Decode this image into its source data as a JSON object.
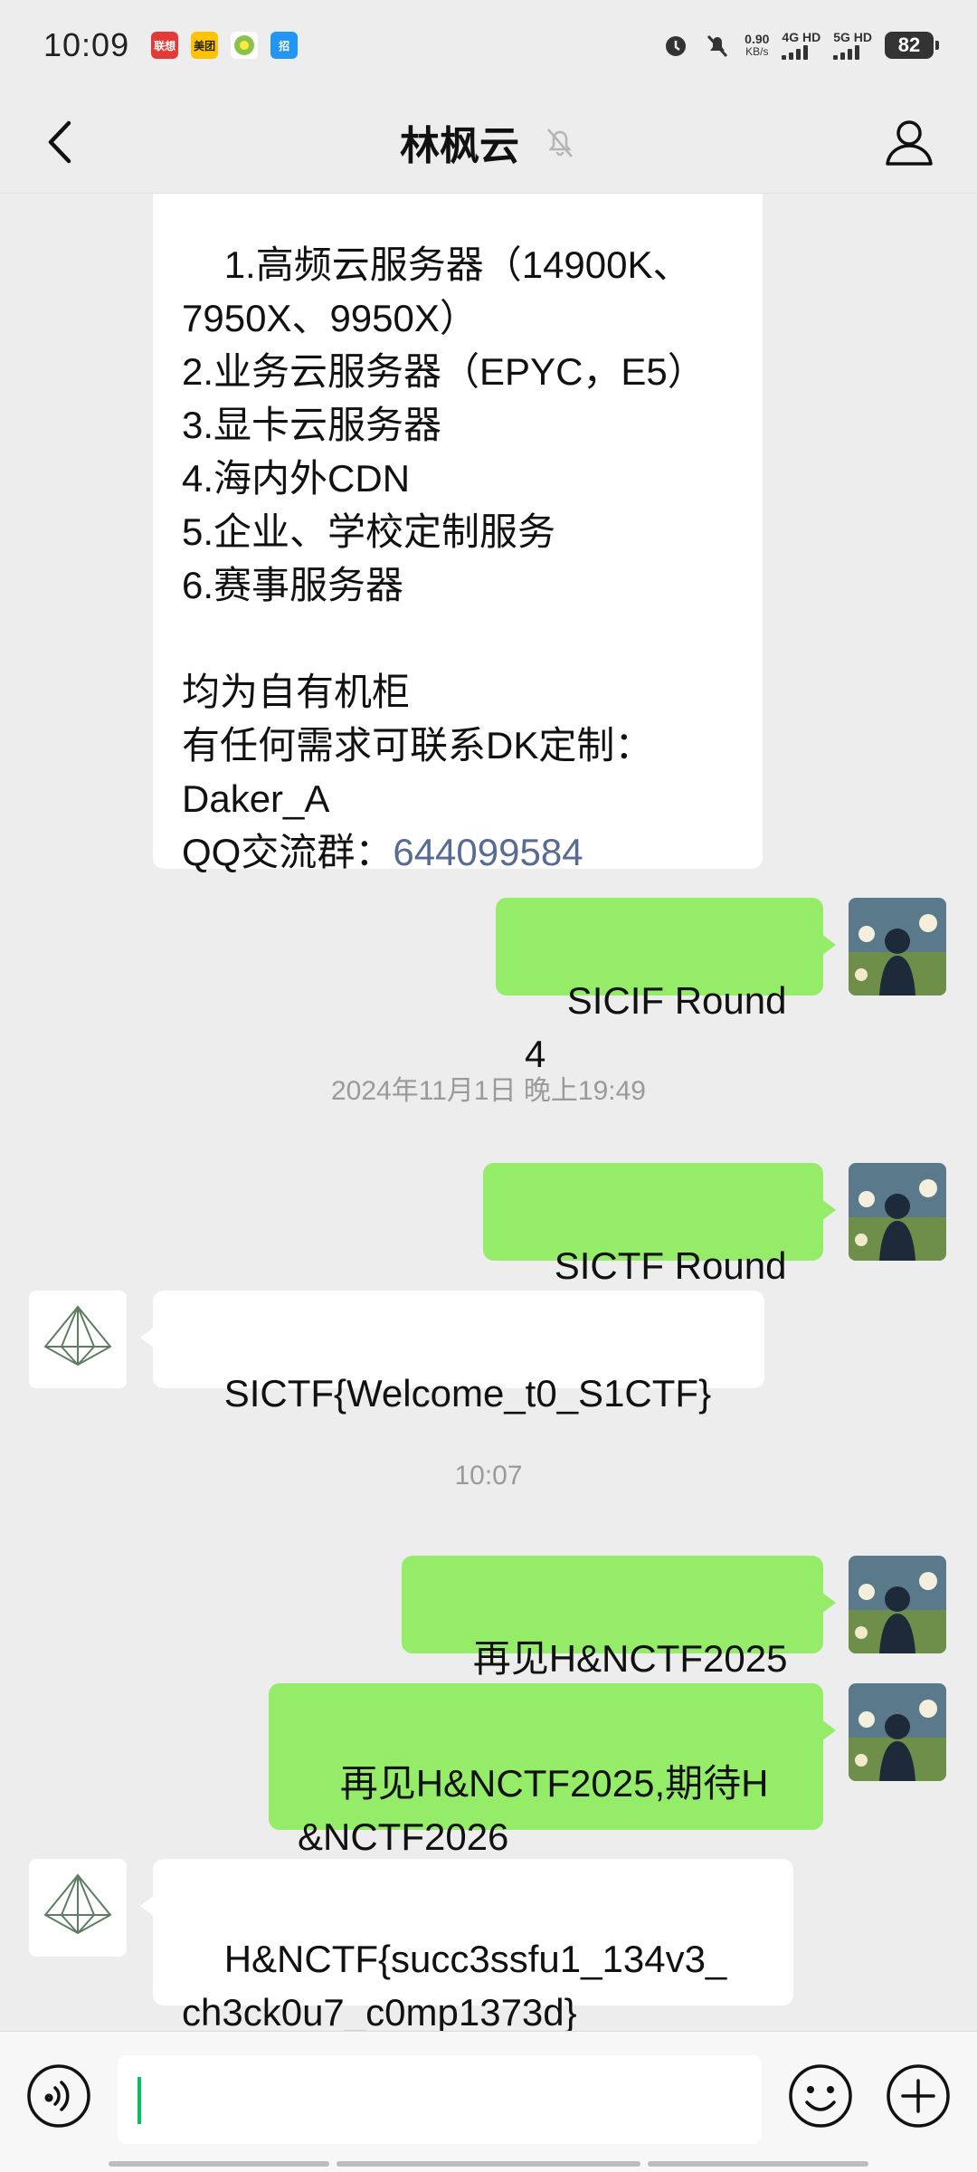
{
  "status_bar": {
    "time": "10:09",
    "app_icons": [
      {
        "name": "lianxiang-app-icon",
        "label": "联想",
        "color": "#e53935"
      },
      {
        "name": "meituan-app-icon",
        "label": "美团",
        "color": "#ffc300"
      },
      {
        "name": "ball-app-icon",
        "label": "",
        "color": "#8bc34a"
      },
      {
        "name": "store-app-icon",
        "label": "招",
        "color": "#2196f3"
      }
    ],
    "speed_value": "0.90",
    "speed_unit": "KB/s",
    "net1": "4G HD",
    "net2": "5G HD",
    "battery": "82"
  },
  "header": {
    "title": "林枫云"
  },
  "messages": {
    "m1": {
      "direction": "in",
      "text": "1.高频云服务器（14900K、\n7950X、9950X）\n2.业务云服务器（EPYC，E5）\n3.显卡云服务器\n4.海内外CDN\n5.企业、学校定制服务\n6.赛事服务器\n\n均为自有机柜\n有任何需求可联系DK定制：\nDaker_A\nQQ交流群：",
      "link": "644099584"
    },
    "m2": {
      "direction": "out",
      "text": "SICIF Round4"
    },
    "sep1": "2024年11月1日 晚上19:49",
    "m3": {
      "direction": "out",
      "text": "SICTF Round4"
    },
    "m4": {
      "direction": "in",
      "text": "SICTF{Welcome_t0_S1CTF}"
    },
    "sep2": "10:07",
    "m5": {
      "direction": "out",
      "text": "再见H&NCTF2025"
    },
    "m6": {
      "direction": "out",
      "text": "再见H&NCTF2025,期待H\n&NCTF2026"
    },
    "m7": {
      "direction": "in",
      "text": "H&NCTF{succ3ssfu1_134v3_\nch3ck0u7_c0mp1373d}"
    }
  },
  "input": {
    "value": ""
  },
  "colors": {
    "background": "#ededed",
    "outgoing_bubble": "#95ec69",
    "incoming_bubble": "#ffffff",
    "link": "#576b95",
    "caret": "#07c160"
  }
}
